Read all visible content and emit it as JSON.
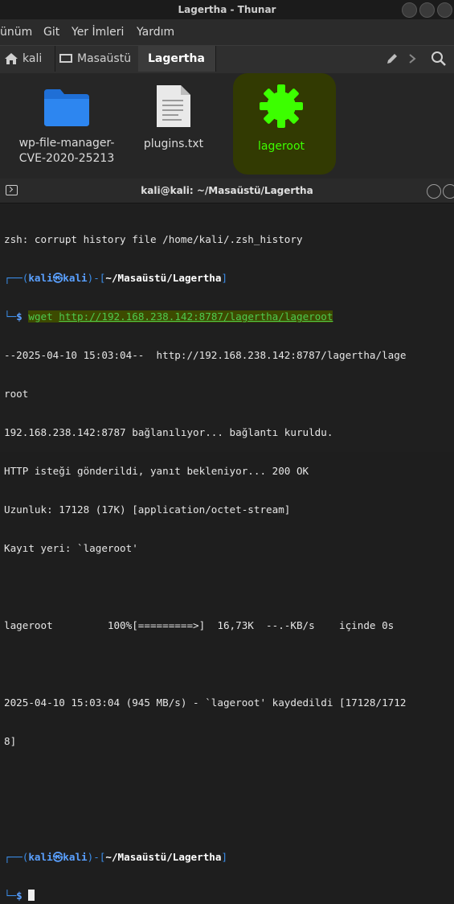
{
  "window": {
    "title": "Lagertha - Thunar"
  },
  "menu": {
    "items": [
      "ünüm",
      "Git",
      "Yer İmleri",
      "Yardım"
    ]
  },
  "pathbar": {
    "crumbs": [
      {
        "label": "kali"
      },
      {
        "label": "Masaüstü"
      },
      {
        "label": "Lagertha"
      }
    ]
  },
  "files": [
    {
      "name_line1": "wp-file-manager-",
      "name_line2": "CVE-2020-25213",
      "type": "folder"
    },
    {
      "name_line1": "plugins.txt",
      "type": "text"
    },
    {
      "name_line1": "lageroot",
      "type": "executable"
    }
  ],
  "terminal": {
    "title": "kali@kali: ~/Masaüstü/Lagertha",
    "l1": "zsh: corrupt history file /home/kali/.zsh_history",
    "p_user": "kali",
    "p_sym": "㉿",
    "p_host": "kali",
    "p_dir": "~/Masaüstü/Lagertha",
    "cmd_prefix": "wget ",
    "cmd_url": "http://192.168.238.142:8787/lagertha/lageroot",
    "l4": "--2025-04-10 15:03:04--  http://192.168.238.142:8787/lagertha/lage",
    "l5": "root",
    "l6": "192.168.238.142:8787 bağlanılıyor... bağlantı kuruldu.",
    "l7": "HTTP isteği gönderildi, yanıt bekleniyor... 200 OK",
    "l8": "Uzunluk: 17128 (17K) [application/octet-stream]",
    "l9": "Kayıt yeri: `lageroot'",
    "l11": "lageroot         100%[=========>]  16,73K  --.-KB/s    içinde 0s",
    "l13": "2025-04-10 15:03:04 (945 MB/s) - `lageroot' kaydedildi [17128/1712",
    "l14": "8]"
  },
  "colors": {
    "terminal_bg": "#1f1f1f",
    "prompt_blue": "#3b8eea",
    "command_green": "#4ec94e",
    "icon_green": "#3cff00"
  }
}
